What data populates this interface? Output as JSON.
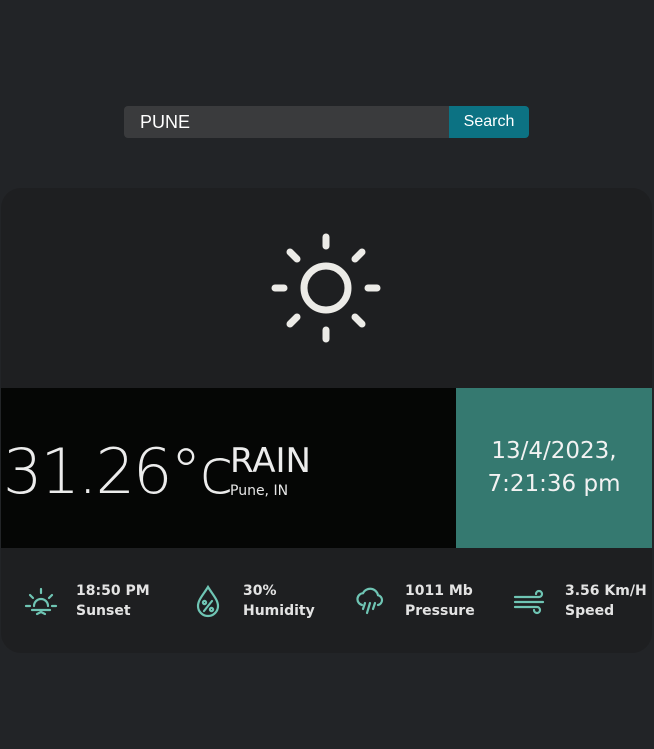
{
  "search": {
    "value": "PUNE",
    "button_label": "Search"
  },
  "weather": {
    "temperature": "31.26°c",
    "condition": "RAIN",
    "location": "Pune, IN",
    "date": "13/4/2023,",
    "time": "7:21:36 pm",
    "hero_icon": "sun-icon"
  },
  "stats": [
    {
      "value": "18:50 PM",
      "label": "Sunset",
      "icon": "sunset-icon"
    },
    {
      "value": "30%",
      "label": "Humidity",
      "icon": "humidity-icon"
    },
    {
      "value": "1011 Mb",
      "label": "Pressure",
      "icon": "rain-cloud-icon"
    },
    {
      "value": "3.56 Km/H",
      "label": "Speed",
      "icon": "wind-icon"
    }
  ],
  "colors": {
    "accent": "#357970",
    "icon": "#6fc5b4",
    "button": "#0c7283",
    "background": "#222427",
    "card": "#1e1f21"
  }
}
